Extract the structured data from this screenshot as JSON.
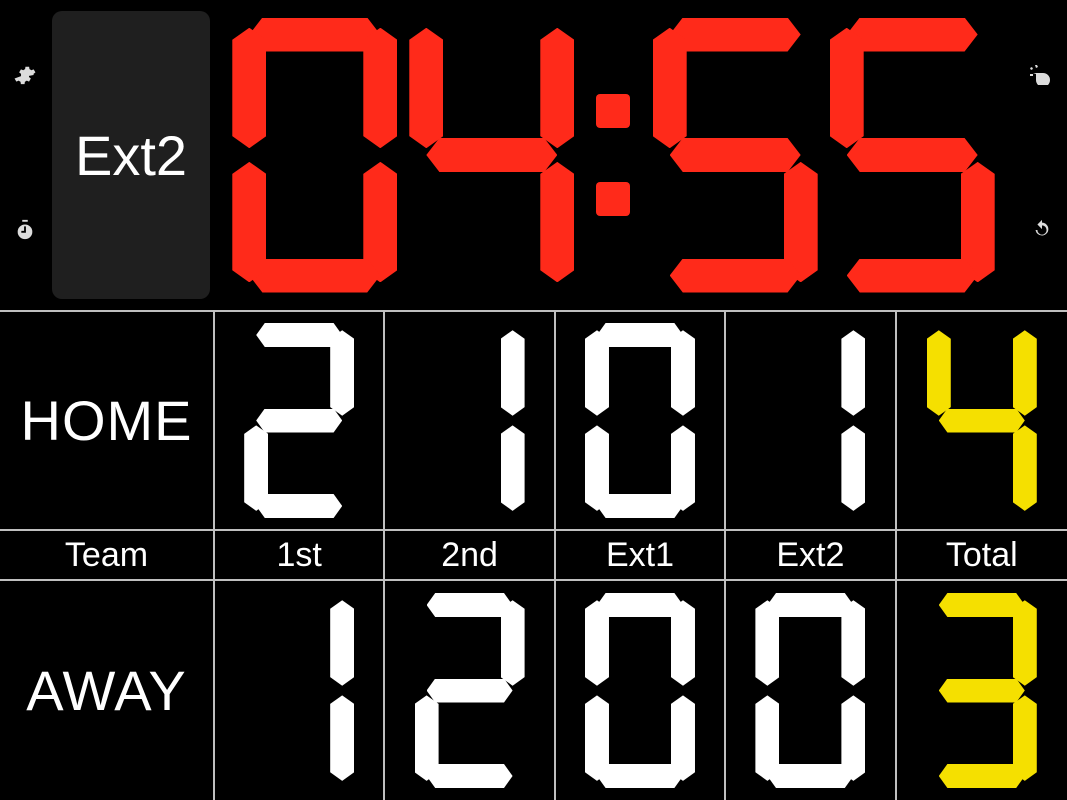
{
  "period": {
    "label": "Ext2"
  },
  "clock": {
    "minutes": "04",
    "seconds": "55",
    "color": "red"
  },
  "columns": [
    "Team",
    "1st",
    "2nd",
    "Ext1",
    "Ext2",
    "Total"
  ],
  "teams": {
    "home": {
      "label": "HOME",
      "scores": {
        "1st": "2",
        "2nd": "1",
        "Ext1": "0",
        "Ext2": "1",
        "Total": "4"
      }
    },
    "away": {
      "label": "AWAY",
      "scores": {
        "1st": "1",
        "2nd": "2",
        "Ext1": "0",
        "Ext2": "0",
        "Total": "3"
      }
    }
  },
  "colors": {
    "clock": "#ff2a1a",
    "score": "#ffffff",
    "total": "#f5e000"
  },
  "icons": {
    "settings": "gear-icon",
    "stopwatch": "stopwatch-icon",
    "whistle": "whistle-icon",
    "reset": "refresh-icon"
  }
}
